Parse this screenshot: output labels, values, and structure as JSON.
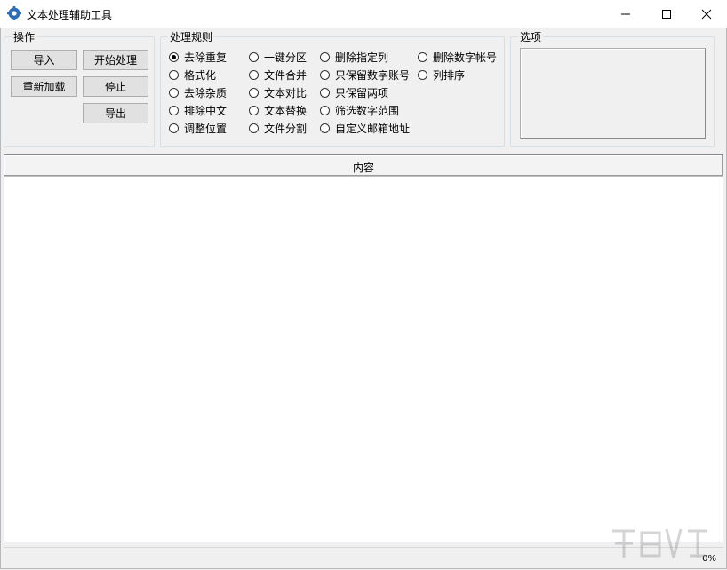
{
  "window": {
    "title": "文本处理辅助工具"
  },
  "operations": {
    "title": "操作",
    "import_label": "导入",
    "start_label": "开始处理",
    "reload_label": "重新加载",
    "stop_label": "停止",
    "export_label": "导出"
  },
  "rules": {
    "title": "处理规则",
    "selected": "去除重复",
    "items": [
      "去除重复",
      "格式化",
      "去除杂质",
      "排除中文",
      "调整位置",
      "一键分区",
      "文件合并",
      "文本对比",
      "文本替换",
      "文件分割",
      "删除指定列",
      "只保留数字账号",
      "只保留两项",
      "筛选数字范围",
      "自定义邮箱地址",
      "删除数字帐号",
      "列排序"
    ]
  },
  "options": {
    "title": "选项"
  },
  "list": {
    "column_header": "内容"
  },
  "status": {
    "progress_text": "0%"
  }
}
